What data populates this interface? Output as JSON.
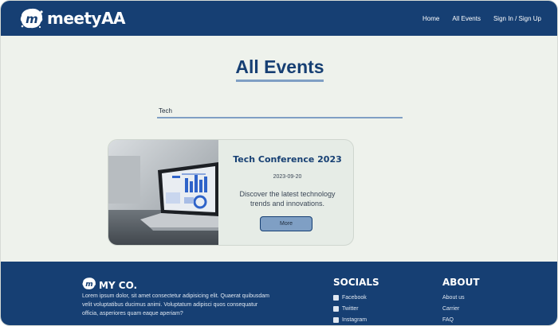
{
  "header": {
    "logo_text": "meetyAA",
    "nav": [
      "Home",
      "All Events",
      "Sign In / Sign Up"
    ]
  },
  "main": {
    "title": "All Events",
    "search": {
      "value": "Tech",
      "placeholder": ""
    }
  },
  "events": [
    {
      "title": "Tech Conference 2023",
      "date": "2023-09-20",
      "description": "Discover the latest technology trends and innovations.",
      "button": "More",
      "image_icon": "laptop-image"
    }
  ],
  "footer": {
    "brand": "MY CO.",
    "about_text": "Lorem ipsum dolor, sit amet consectetur adipisicing elit. Quaerat quibusdam velit voluptatibus ducimus animi. Voluptatum adipisci quos consequatur officia, asperiores quam eaque aperiam?",
    "socials_title": "SOCIALS",
    "socials": [
      {
        "label": "Facebook",
        "icon": "facebook-icon"
      },
      {
        "label": "Twitter",
        "icon": "twitter-icon"
      },
      {
        "label": "Instagram",
        "icon": "instagram-icon"
      }
    ],
    "about_title": "ABOUT",
    "about_links": [
      "About us",
      "Carrier",
      "FAQ"
    ]
  },
  "colors": {
    "primary": "#163f73",
    "accent": "#7f9fc4",
    "background": "#eef2ec"
  }
}
